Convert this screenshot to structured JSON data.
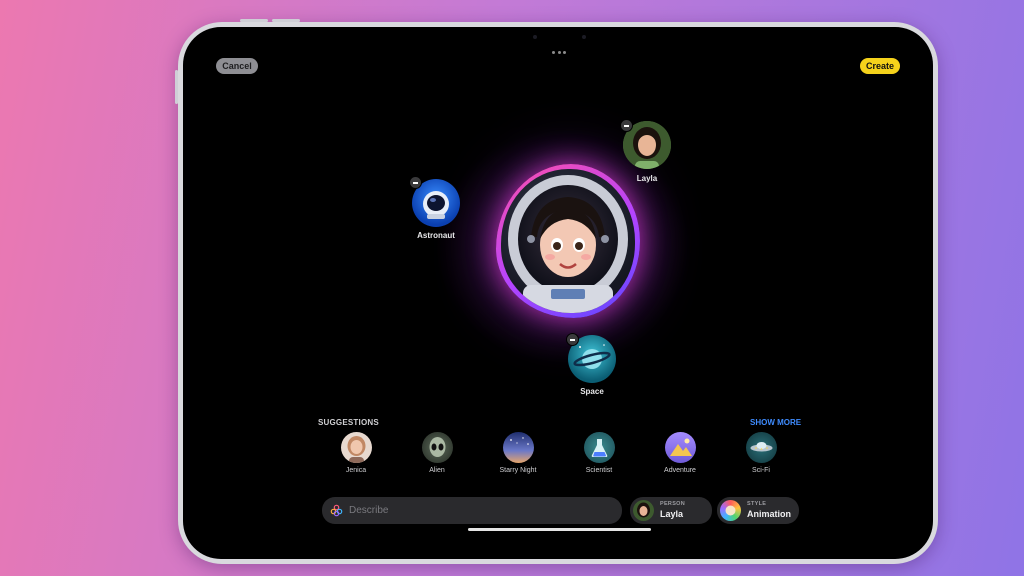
{
  "toolbar": {
    "cancel_label": "Cancel",
    "create_label": "Create"
  },
  "canvas": {
    "concepts": [
      {
        "label": "Astronaut",
        "icon": "astronaut-helmet-icon"
      },
      {
        "label": "Layla",
        "icon": "person-photo"
      },
      {
        "label": "Space",
        "icon": "planet-icon"
      }
    ]
  },
  "suggestions": {
    "title": "SUGGESTIONS",
    "show_more": "SHOW MORE",
    "items": [
      {
        "label": "Jenica",
        "icon": "person-photo"
      },
      {
        "label": "Alien",
        "icon": "alien-icon"
      },
      {
        "label": "Starry Night",
        "icon": "starry-night-icon"
      },
      {
        "label": "Scientist",
        "icon": "flask-icon"
      },
      {
        "label": "Adventure",
        "icon": "adventure-icon"
      },
      {
        "label": "Sci-Fi",
        "icon": "ufo-icon"
      }
    ]
  },
  "composer": {
    "placeholder": "Describe",
    "person": {
      "caption": "PERSON",
      "value": "Layla"
    },
    "style": {
      "caption": "STYLE",
      "value": "Animation"
    }
  },
  "colors": {
    "accent_link": "#3f8cff",
    "create_button": "#f5d21b",
    "glow": "#d94fd0"
  }
}
